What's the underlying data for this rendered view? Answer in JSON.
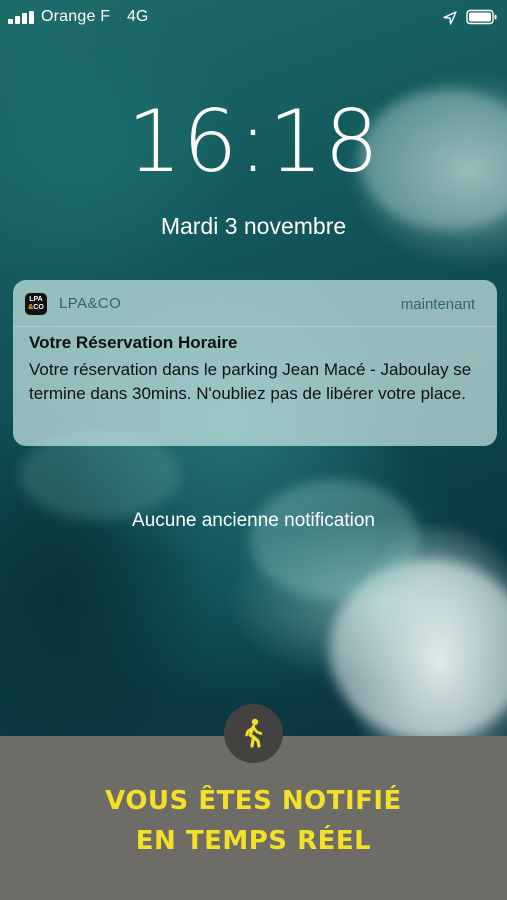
{
  "status_bar": {
    "carrier": "Orange F",
    "network": "4G",
    "signal_bars": 4,
    "icons": [
      "signal-icon",
      "location-icon",
      "battery-icon"
    ]
  },
  "lockscreen": {
    "time": "16:18",
    "date": "Mardi 3 novembre"
  },
  "notification": {
    "app_icon_text": {
      "line1": "LPA",
      "line2_a": "&",
      "line2_b": "CO"
    },
    "app_name": "LPA&CO",
    "timestamp": "maintenant",
    "title": "Votre Réservation Horaire",
    "body": "Votre réservation dans le parking Jean Macé - Jaboulay se termine dans 30mins. N'oubliez pas de libérer votre place."
  },
  "no_older_notifications": "Aucune ancienne notification",
  "banner": {
    "icon": "walking-person-icon",
    "line1": "VOUS ÊTES NOTIFIÉ",
    "line2": "EN TEMPS RÉEL"
  },
  "colors": {
    "banner_background": "#6e6c67",
    "banner_text": "#f3e128",
    "badge": "#434241",
    "notification_app_name": "#2e6a62"
  }
}
